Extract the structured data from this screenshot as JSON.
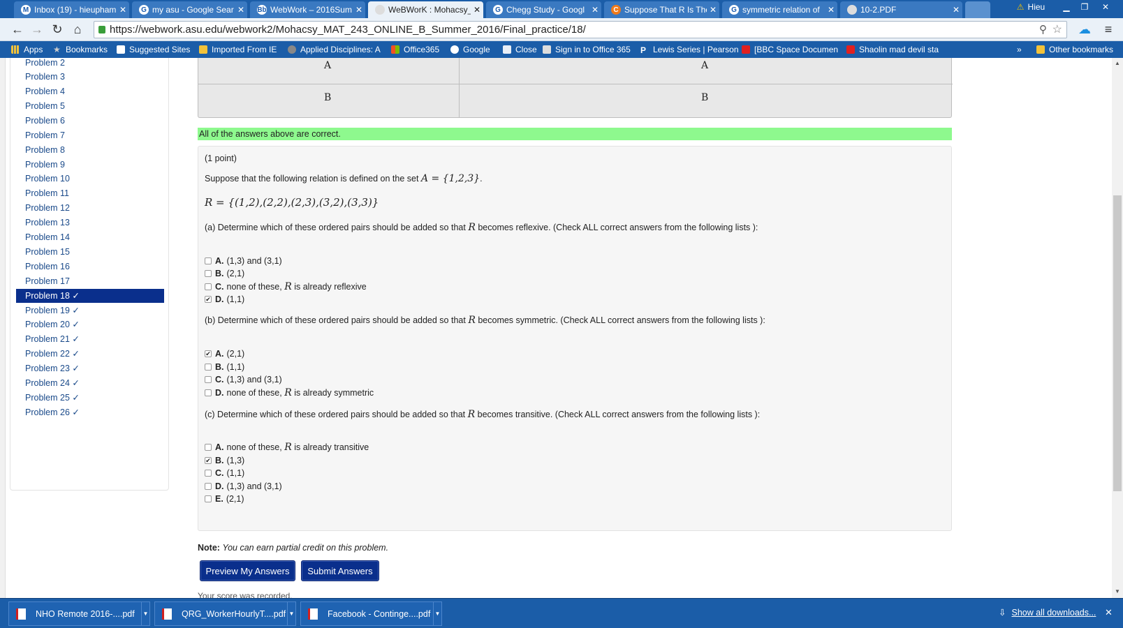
{
  "browser": {
    "tabs": [
      {
        "title": "Inbox (19) - hieupham",
        "icon": "gmail-icon",
        "icon_glyph": "M"
      },
      {
        "title": "my asu - Google Sear",
        "icon": "google-icon",
        "icon_glyph": "G"
      },
      {
        "title": "WebWork – 2016Sum",
        "icon": "blackboard-icon",
        "icon_glyph": "Bb"
      },
      {
        "title": "WeBWorK : Mohacsy_",
        "icon": "page-icon",
        "icon_glyph": ""
      },
      {
        "title": "Chegg Study - Googl",
        "icon": "google-icon",
        "icon_glyph": "G"
      },
      {
        "title": "Suppose That R Is The",
        "icon": "chegg-icon",
        "icon_glyph": "C"
      },
      {
        "title": "symmetric relation of",
        "icon": "google-icon",
        "icon_glyph": "G"
      },
      {
        "title": "10-2.PDF",
        "icon": "page-icon",
        "icon_glyph": ""
      }
    ],
    "user": "Hieu",
    "url": "https://webwork.asu.edu/webwork2/Mohacsy_MAT_243_ONLINE_B_Summer_2016/Final_practice/18/",
    "bookmarks": [
      "Apps",
      "Bookmarks",
      "Suggested Sites",
      "Imported From IE",
      "Applied Disciplines: A",
      "Office365",
      "Google",
      "Close",
      "Sign in to Office 365",
      "Lewis Series | Pearson",
      "[BBC Space Documen",
      "Shaolin mad devil sta"
    ],
    "bookmarks_more": "»",
    "other_bookmarks": "Other bookmarks"
  },
  "sidebar": {
    "items": [
      "Problem 2",
      "Problem 3",
      "Problem 4",
      "Problem 5",
      "Problem 6",
      "Problem 7",
      "Problem 8",
      "Problem 9",
      "Problem 10",
      "Problem 11",
      "Problem 12",
      "Problem 13",
      "Problem 14",
      "Problem 15",
      "Problem 16",
      "Problem 17",
      "Problem 18 ✓",
      "Problem 19 ✓",
      "Problem 20 ✓",
      "Problem 21 ✓",
      "Problem 22 ✓",
      "Problem 23 ✓",
      "Problem 24 ✓",
      "Problem 25 ✓",
      "Problem 26 ✓"
    ],
    "active": "Problem 18 ✓"
  },
  "results_table": {
    "rows": [
      [
        "A",
        "A"
      ],
      [
        "B",
        "B"
      ]
    ]
  },
  "correct_message": "All of the answers above are correct.",
  "problem": {
    "points": "(1 point)",
    "intro": "Suppose that the following relation is defined on the set ",
    "set_math": "A = {1,2,3}",
    "relation": "R = {(1,2),(2,2),(2,3),(3,2),(3,3)}",
    "part_a": {
      "pre": "(a) Determine which of these ordered pairs should be added so that ",
      "post": " becomes reflexive. (Check ALL correct answers from the following lists ):",
      "options": [
        {
          "letter": "A.",
          "text": "(1,3) and (3,1)",
          "checked": false
        },
        {
          "letter": "B.",
          "text": "(2,1)",
          "checked": false
        },
        {
          "letter": "C.",
          "text": "none of these, ",
          "tail": " is already reflexive",
          "checked": false
        },
        {
          "letter": "D.",
          "text": "(1,1)",
          "checked": true
        }
      ]
    },
    "part_b": {
      "pre": "(b) Determine which of these ordered pairs should be added so that ",
      "post": " becomes symmetric. (Check ALL correct answers from the following lists ):",
      "options": [
        {
          "letter": "A.",
          "text": "(2,1)",
          "checked": true
        },
        {
          "letter": "B.",
          "text": "(1,1)",
          "checked": false
        },
        {
          "letter": "C.",
          "text": "(1,3) and (3,1)",
          "checked": false
        },
        {
          "letter": "D.",
          "text": "none of these, ",
          "tail": " is already symmetric",
          "checked": false
        }
      ]
    },
    "part_c": {
      "pre": "(c) Determine which of these ordered pairs should be added so that ",
      "post": " becomes transitive. (Check ALL correct answers from the following lists ):",
      "options": [
        {
          "letter": "A.",
          "text": "none of these, ",
          "tail": " is already transitive",
          "checked": false
        },
        {
          "letter": "B.",
          "text": "(1,3)",
          "checked": true
        },
        {
          "letter": "C.",
          "text": "(1,1)",
          "checked": false
        },
        {
          "letter": "D.",
          "text": "(1,3) and (3,1)",
          "checked": false
        },
        {
          "letter": "E.",
          "text": "(2,1)",
          "checked": false
        }
      ]
    },
    "r_symbol": "R"
  },
  "note": {
    "label": "Note:",
    "text": "You can earn partial credit on this problem."
  },
  "buttons": {
    "preview": "Preview My Answers",
    "submit": "Submit Answers"
  },
  "score_message": "Your score was recorded.",
  "downloads": {
    "items": [
      "NHO Remote 2016-....pdf",
      "QRG_WorkerHourlyT....pdf",
      "Facebook - Continge....pdf"
    ],
    "show_all": "Show all downloads..."
  },
  "colors": {
    "tabstrip": "#1b5da8",
    "active_nav": "#0a2f8c",
    "correct_bg": "#8ef98e"
  }
}
